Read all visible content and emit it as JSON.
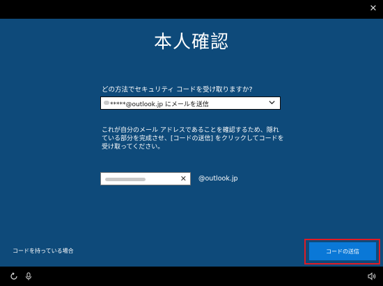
{
  "title": "本人確認",
  "question": "どの方法でセキュリティ コードを受け取りますか?",
  "method_select": {
    "selected_value": "*****@outlook.jp にメールを送信"
  },
  "description": "これが自分のメール アドレスであることを確認するため、隠れている部分を完成させ、[コードの送信] をクリックしてコードを受け取ってください。",
  "email_input": {
    "domain_suffix": "@outlook.jp"
  },
  "have_code_link": "コードを持っている場合",
  "send_button": "コードの送信",
  "colors": {
    "background": "#0e4a7a",
    "button": "#0a78d7",
    "highlight": "#e01b24"
  },
  "icons": {
    "close": "close-icon",
    "chevron": "chevron-down-icon",
    "clear": "clear-icon",
    "ease_of_access": "ease-of-access-icon",
    "microphone": "microphone-icon",
    "volume": "volume-icon"
  }
}
